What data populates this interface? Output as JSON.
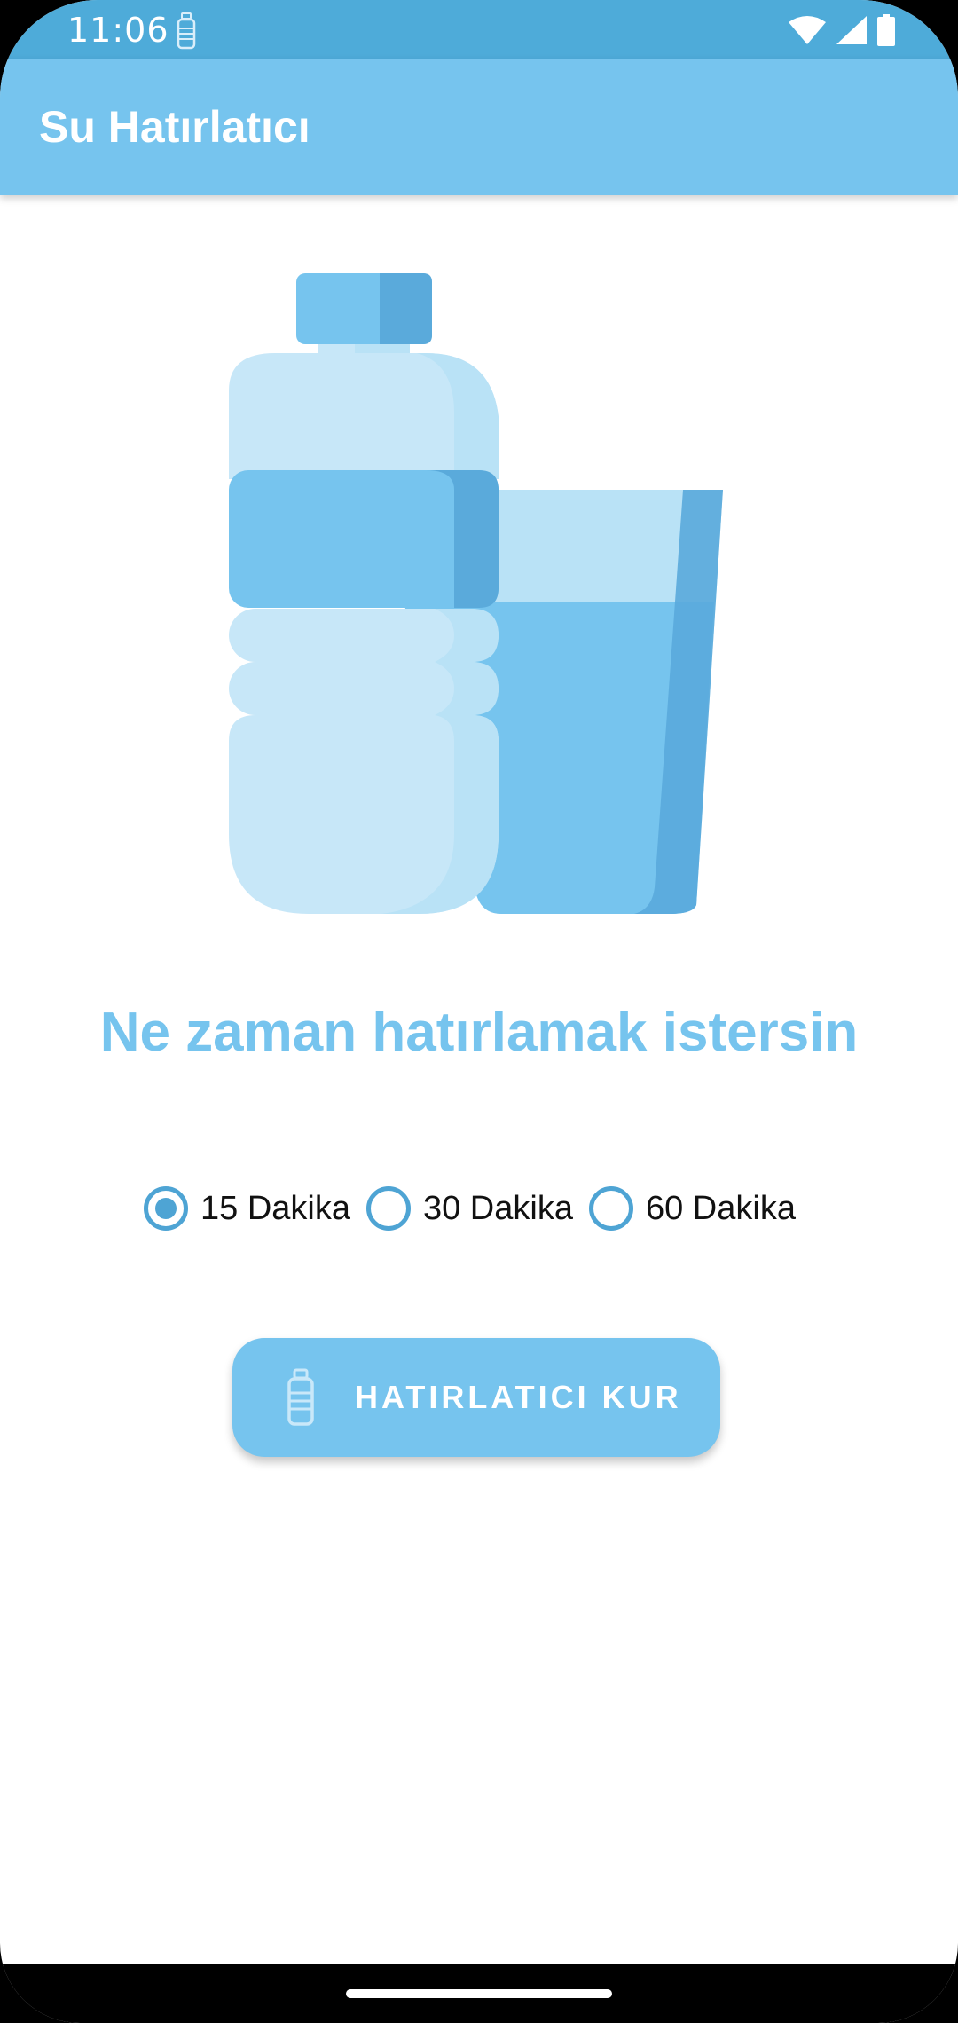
{
  "status_bar": {
    "time": "11:06",
    "icons": [
      "bottle-notification-icon",
      "wifi-icon",
      "signal-icon",
      "battery-icon"
    ]
  },
  "app_bar": {
    "title": "Su Hatırlatıcı"
  },
  "illustration": {
    "name": "water-bottle-and-glass-illustration"
  },
  "question": "Ne zaman hatırlamak istersin",
  "radio_options": [
    {
      "label": "15 Dakika",
      "checked": true
    },
    {
      "label": "30 Dakika",
      "checked": false
    },
    {
      "label": "60 Dakika",
      "checked": false
    }
  ],
  "button": {
    "label": "HATIRLATICI KUR",
    "icon": "bottle-icon"
  },
  "colors": {
    "status_bar": "#4eabd9",
    "primary": "#76c4ee",
    "radio_accent": "#4ea4d4"
  }
}
